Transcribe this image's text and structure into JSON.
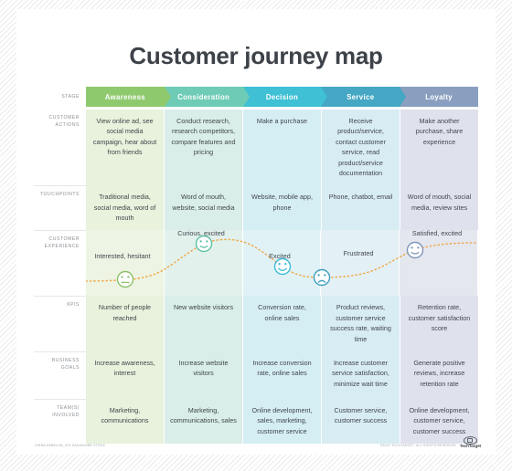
{
  "page": {
    "title": "Customer journey map"
  },
  "colors": {
    "awareness": "#8fc96e",
    "consideration": "#6ecbb5",
    "decision": "#3fc0d4",
    "service": "#45a7c4",
    "loyalty": "#8a9fc0",
    "awareness_tint": "#e8f2dc",
    "consideration_tint": "#d9eee8",
    "decision_tint": "#d5eef4",
    "service_tint": "#d8ecf3",
    "loyalty_tint": "#dfe2ec",
    "curve": "#f0a94a",
    "title_text": "#3d4249",
    "label_text": "#8b9096"
  },
  "row_labels": {
    "stage": "Stage",
    "customer_actions": "Customer actions",
    "touchpoints": "Touchpoints",
    "customer_experience": "Customer experience",
    "kpis": "KPIs",
    "business_goals": "Business goals",
    "teams_involved": "Team(s) involved"
  },
  "stages": [
    {
      "name": "Awareness"
    },
    {
      "name": "Consideration"
    },
    {
      "name": "Decision"
    },
    {
      "name": "Service"
    },
    {
      "name": "Loyalty"
    }
  ],
  "rows": {
    "customer_actions": [
      "View online ad, see social media campaign, hear about from friends",
      "Conduct research, research competitors, compare features and pricing",
      "Make a purchase",
      "Receive product/service, contact customer service, read product/service documentation",
      "Make another purchase, share experience"
    ],
    "touchpoints": [
      "Traditional media, social media, word of mouth",
      "Word of mouth, website, social media",
      "Website, mobile app, phone",
      "Phone, chatbot, email",
      "Word of mouth, social media, review sites"
    ],
    "customer_experience": [
      {
        "label": "Interested, hesitant",
        "mood": "neutral"
      },
      {
        "label": "Curious, excited",
        "mood": "neutral-happy"
      },
      {
        "label": "Excited",
        "mood": "happy"
      },
      {
        "label": "Frustrated",
        "mood": "sad"
      },
      {
        "label": "Satisfied, excited",
        "mood": "neutral-happy"
      }
    ],
    "kpis": [
      "Number of people reached",
      "New website visitors",
      "Conversion rate, online sales",
      "Product reviews, customer service success rate, waiting time",
      "Retention rate, customer satisfaction score"
    ],
    "business_goals": [
      "Increase awareness, interest",
      "Increase website visitors",
      "Increase conversion rate, online sales",
      "Increase customer service satisfaction, minimize wait time",
      "Generate positive reviews, increase retention rate"
    ],
    "teams_involved": [
      "Marketing, communications",
      "Marketing, communications, sales",
      "Online development, sales, marketing, customer service",
      "Customer service, customer success",
      "Online development, customer service, customer success"
    ]
  },
  "footer": {
    "source": "China Unbelun_ico.gau/adobe stock",
    "copyright": "©2022 TechTarget, all rights reserved",
    "brand": "TechTarget"
  }
}
